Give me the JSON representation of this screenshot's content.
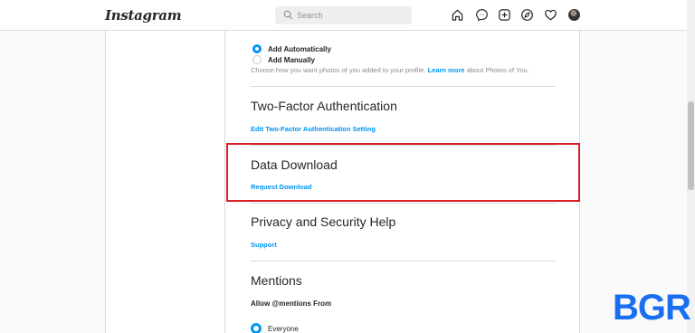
{
  "header": {
    "logo": "Instagram",
    "search_placeholder": "Search",
    "icons": [
      "home-icon",
      "messenger-icon",
      "new-post-icon",
      "explore-icon",
      "activity-heart-icon",
      "profile-avatar"
    ]
  },
  "photos_of_you": {
    "options": [
      {
        "label": "Add Automatically",
        "selected": true
      },
      {
        "label": "Add Manually",
        "selected": false
      }
    ],
    "help_prefix": "Choose how you want photos of you added to your profile.",
    "help_link": "Learn more",
    "help_suffix": "about Photos of You."
  },
  "two_factor": {
    "title": "Two-Factor Authentication",
    "link": "Edit Two-Factor Authentication Setting"
  },
  "data_download": {
    "title": "Data Download",
    "link": "Request Download"
  },
  "privacy_help": {
    "title": "Privacy and Security Help",
    "link": "Support"
  },
  "mentions": {
    "title": "Mentions",
    "subheading": "Allow @mentions From",
    "option": "Everyone"
  },
  "watermark": "BGR",
  "colors": {
    "accent": "#0095f6",
    "highlight": "#d91f26",
    "watermark": "#1a6ef0"
  }
}
